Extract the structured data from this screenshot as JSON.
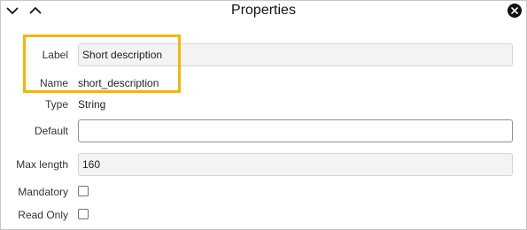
{
  "window": {
    "title": "Properties",
    "nav_down_icon": "chevron-down-icon",
    "nav_up_icon": "chevron-up-icon",
    "close_icon": "close-icon"
  },
  "fields": {
    "label": {
      "caption": "Label",
      "value": "Short description"
    },
    "name": {
      "caption": "Name",
      "value": "short_description"
    },
    "type": {
      "caption": "Type",
      "value": "String"
    },
    "default": {
      "caption": "Default",
      "value": ""
    },
    "max_length": {
      "caption": "Max length",
      "value": "160"
    },
    "mandatory": {
      "caption": "Mandatory",
      "checked": false
    },
    "read_only": {
      "caption": "Read Only",
      "checked": false
    }
  },
  "highlight_color": "#f7b500"
}
